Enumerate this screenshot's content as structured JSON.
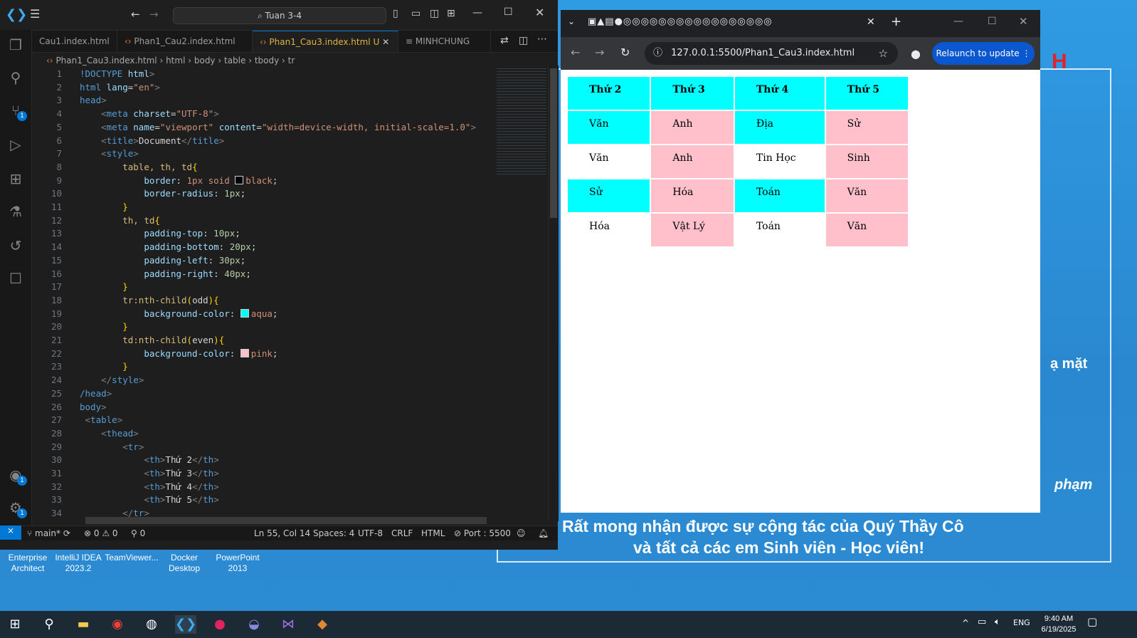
{
  "desktop": {
    "bg_line1": "Rất mong nhận được sự cộng tác của Quý Thầy Cô",
    "bg_line2": "và tất cả các em Sinh viên - Học viên!",
    "bg_side1": "ạ mặt",
    "bg_side2": "phạm",
    "bg_letter": "H",
    "icons": [
      {
        "label": "Enterprise Architect"
      },
      {
        "label": "IntelliJ IDEA 2023.2"
      },
      {
        "label": "TeamViewer..."
      },
      {
        "label": "Docker Desktop"
      },
      {
        "label": "PowerPoint 2013"
      }
    ]
  },
  "vscode": {
    "search": "Tuan 3-4",
    "tabs": [
      {
        "label": "Cau1.index.html"
      },
      {
        "label": "Phan1_Cau2.index.html"
      },
      {
        "label": "Phan1_Cau3.index.html",
        "modified": "U"
      },
      {
        "label": "MINHCHUNG"
      }
    ],
    "breadcrumb": [
      "Phan1_Cau3.index.html",
      "html",
      "body",
      "table",
      "tbody",
      "tr"
    ],
    "status": {
      "branch": "main*",
      "errors": "0",
      "warnings": "0",
      "ports": "0",
      "position": "Ln 55, Col 14",
      "spaces": "Spaces: 4",
      "encoding": "UTF-8",
      "eol": "CRLF",
      "language": "HTML",
      "port": "Port : 5500"
    },
    "badges": {
      "scm": "1",
      "accounts": "1",
      "settings": "1"
    },
    "code_lines": [
      "1",
      "2",
      "3",
      "4",
      "5",
      "6",
      "7",
      "8",
      "9",
      "10",
      "11",
      "12",
      "13",
      "14",
      "15",
      "16",
      "17",
      "18",
      "19",
      "20",
      "21",
      "22",
      "23",
      "24",
      "25",
      "26",
      "27",
      "28",
      "29",
      "30",
      "31",
      "32",
      "33",
      "34"
    ],
    "code": {
      "doctype": "!DOCTYPE",
      "html_kw": "html",
      "lang_attr": "lang",
      "lang_val": "\"en\"",
      "head": "head",
      "meta": "meta",
      "charset": "charset",
      "charset_val": "\"UTF-8\"",
      "name_attr": "name",
      "name_val": "\"viewport\"",
      "content_attr": "content",
      "content_val": "\"width=device-width, initial-scale=1.0\"",
      "title": "title",
      "title_text": "Document",
      "style": "style",
      "sel1": "table, th, td",
      "border_prop": "border",
      "border_val": "1px soid ",
      "border_color": "black",
      "radius_prop": "border-radius",
      "radius_val": "1px",
      "sel2": "th, td",
      "pt_prop": "padding-top",
      "pt_val": "10px",
      "pb_prop": "padding-bottom",
      "pb_val": "20px",
      "pleft_prop": "padding-left",
      "pleft_val": "30px",
      "pr_prop": "padding-right",
      "pr_val": "40px",
      "sel3": "tr:nth-child",
      "odd": "odd",
      "bg_prop": "background-color",
      "aqua": "aqua",
      "sel4": "td:nth-child",
      "even": "even",
      "pink": "pink",
      "body": "body",
      "table": "table",
      "thead": "thead",
      "tr": "tr",
      "th": "th",
      "th1": "Thứ 2",
      "th2": "Thứ 3",
      "th3": "Thứ 4",
      "th4": "Thứ 5"
    }
  },
  "chrome": {
    "url": "127.0.0.1:5500/Phan1_Cau3.index.html",
    "relaunch": "Relaunch to update",
    "headers": [
      "Thứ 2",
      "Thứ 3",
      "Thứ 4",
      "Thứ 5"
    ],
    "rows": [
      [
        "Văn",
        "Anh",
        "Địa",
        "Sử"
      ],
      [
        "Văn",
        "Anh",
        "Tin Học",
        "Sinh"
      ],
      [
        "Sử",
        "Hóa",
        "Toán",
        "Văn"
      ],
      [
        "Hóa",
        "Vật Lý",
        "Toán",
        "Văn"
      ]
    ],
    "colors": {
      "aqua": "#00ffff",
      "pink": "#ffc0cb"
    }
  },
  "taskbar": {
    "time": "9:40 AM",
    "date": "6/19/2025",
    "lang": "ENG"
  }
}
